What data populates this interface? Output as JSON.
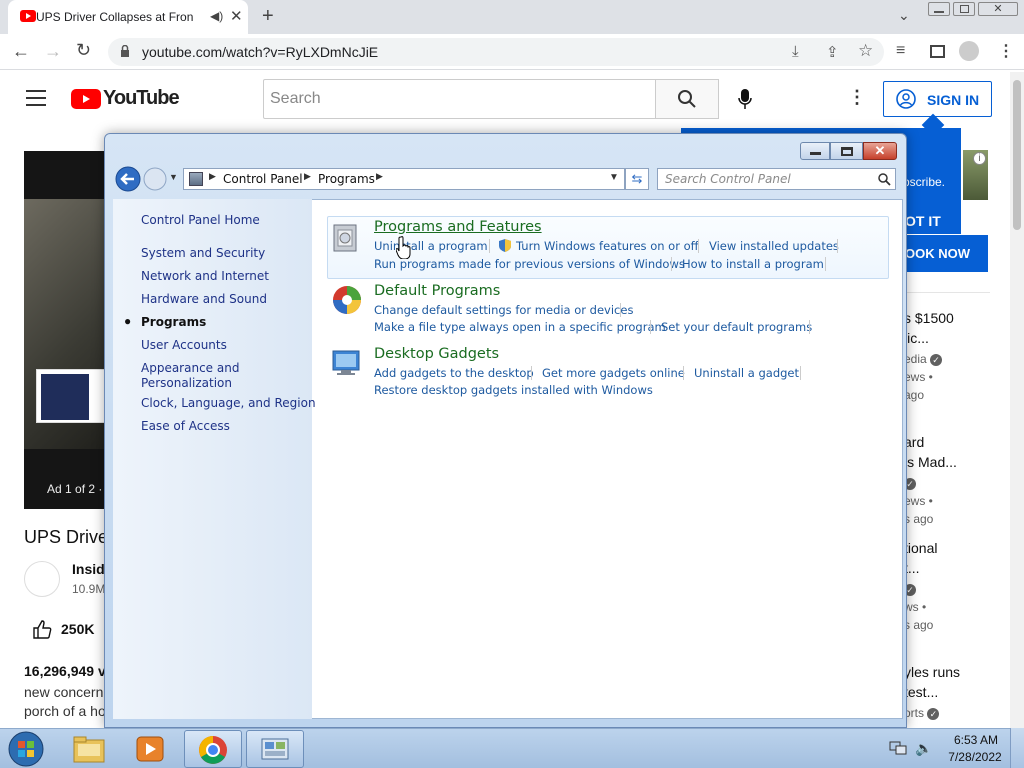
{
  "browser": {
    "tab_title": "UPS Driver Collapses at Fron",
    "url": "youtube.com/watch?v=RyLXDmNcJiE"
  },
  "youtube": {
    "logo_text": "YouTube",
    "search_placeholder": "Search",
    "signin_label": "SIGN IN",
    "ad_label": "Ad 1 of 2 ·",
    "video_title": "UPS Drive",
    "channel_name": "Insid",
    "subscribers": "10.9M",
    "likes": "250K",
    "views": "16,296,949 v",
    "desc1": "new concern",
    "desc2": "porch of a ho",
    "ad_subscribe": "bscribe.",
    "ad_got_it": "OT IT",
    "ad_book": "OOK NOW",
    "sidebar": [
      {
        "l1": "s $1500",
        "l2": "lic...",
        "l3": "edia",
        "l4": "ews •",
        "l5": "ago"
      },
      {
        "l1": "ard",
        "l2": "ls Mad...",
        "l3": "",
        "l4": "ews •",
        "l5": "s ago"
      },
      {
        "l1": "tional",
        "l2": "t...",
        "l3": "",
        "l4": "ws •",
        "l5": "s ago"
      },
      {
        "l1": "yles runs",
        "l2": "test...",
        "l3": "orts",
        "l4": "",
        "l5": ""
      }
    ]
  },
  "control_panel": {
    "breadcrumb": [
      "Control Panel",
      "Programs"
    ],
    "search_placeholder": "Search Control Panel",
    "left_nav": [
      "Control Panel Home",
      "System and Security",
      "Network and Internet",
      "Hardware and Sound",
      "Programs",
      "User Accounts",
      "Appearance and Personalization",
      "Clock, Language, and Region",
      "Ease of Access"
    ],
    "categories": [
      {
        "title": "Programs and Features",
        "row1": [
          "Uninstall a program",
          "Turn Windows features on or off",
          "View installed updates"
        ],
        "row2": [
          "Run programs made for previous versions of Windows",
          "How to install a program"
        ]
      },
      {
        "title": "Default Programs",
        "row1": [
          "Change default settings for media or devices"
        ],
        "row2": [
          "Make a file type always open in a specific program",
          "Set your default programs"
        ]
      },
      {
        "title": "Desktop Gadgets",
        "row1": [
          "Add gadgets to the desktop",
          "Get more gadgets online",
          "Uninstall a gadget"
        ],
        "row2": [
          "Restore desktop gadgets installed with Windows"
        ]
      }
    ]
  },
  "taskbar": {
    "time": "6:53 AM",
    "date": "7/28/2022"
  }
}
